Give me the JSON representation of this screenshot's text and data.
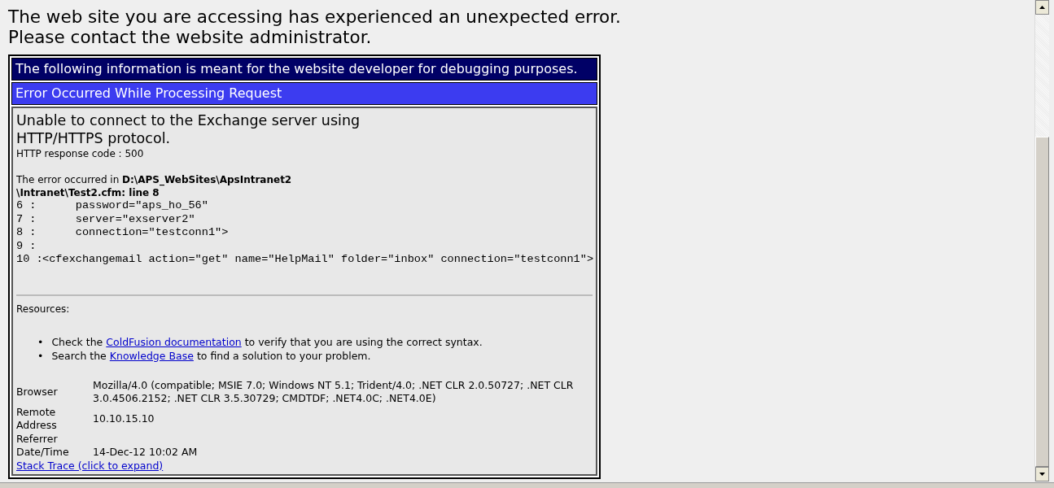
{
  "message": [
    "The web site you are accessing has experienced an unexpected error.",
    "Please contact the website administrator."
  ],
  "debug_header": "The following information is meant for the website developer for debugging purposes.",
  "error_header": "Error Occurred While Processing Request",
  "error_title": [
    "Unable to connect to the Exchange server using",
    "HTTP/HTTPS protocol."
  ],
  "response_code": "HTTP response code : 500",
  "error_location": "The error occurred in **D:\\APS_WebSites\\ApsIntranet2**\n**\\Intranet\\Test2.cfm: line 8**",
  "code_lines": [
    {
      "number": "6 :",
      "code": "     password=\"aps_ho_56\""
    },
    {
      "number": "7 :",
      "code": "     server=\"exserver2\""
    },
    {
      "number": "8 :",
      "code": "     connection=\"testconn1\">"
    },
    {
      "number": "9 :"
    },
    {
      "number": "10 :",
      "code": "<cfexchangemail action=\"get\" name=\"HelpMail\" folder=\"inbox\" connection=\"testconn1\">"
    }
  ],
  "resources_label": "Resources:",
  "resources": [
    {
      "bullet": "•",
      "before": "Check the ",
      "link": "ColdFusion documentation",
      "after": " to verify that you are using the correct syntax."
    },
    {
      "bullet": "•",
      "before": "Search the ",
      "link": "Knowledge Base",
      "after": " to find a solution to your problem."
    }
  ],
  "details": [
    {
      "label": "Browser",
      "value": "Mozilla/4.0 (compatible; MSIE 7.0; Windows NT 5.1; Trident/4.0; .NET CLR 2.0.50727; .NET CLR 3.0.4506.2152; .NET CLR 3.5.30729; CMDTDF; .NET4.0C; .NET4.0E)"
    },
    {
      "label": "Remote Address",
      "value": "10.10.15.10"
    },
    {
      "label": "Referrer"
    },
    {
      "label": "Date/Time",
      "value": "14-Dec-12 10:02 AM"
    }
  ],
  "stack_trace_link": "Stack Trace (click to expand)"
}
